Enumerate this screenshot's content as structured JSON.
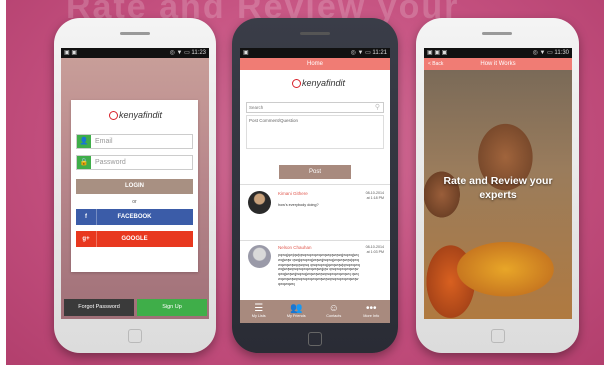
{
  "background_text": "Rate and Review your",
  "colors": {
    "brand_red": "#d8202a",
    "header_coral": "#f07c74",
    "facebook": "#3b5ca8",
    "google": "#e8381f",
    "green": "#3fae49",
    "tan": "#a88a7e"
  },
  "phone1": {
    "status": {
      "left": "▣ ▣",
      "right": "◎ ▼ ▭ 11:23"
    },
    "logo": "kenyafindit",
    "email_placeholder": "Email",
    "password_placeholder": "Password",
    "login_label": "LOGIN",
    "or_label": "or",
    "facebook_label": "FACEBOOK",
    "facebook_icon": "f",
    "google_label": "GOOGLE",
    "google_icon": "g+",
    "forgot_label": "Forgot Password",
    "signup_label": "Sign Up"
  },
  "phone2": {
    "status": {
      "left": "▣",
      "right": "◎ ▼ ▭ 11:21"
    },
    "header_title": "Home",
    "logo": "kenyafindit",
    "search_placeholder": "Search",
    "comment_placeholder": "Post Comment/Question",
    "post_label": "Post",
    "posts": [
      {
        "name": "Kimani Githere",
        "time": "08-10-2014\nat 1:18 PM",
        "body": "how's everybody doing?"
      },
      {
        "name": "Nelson Chauhan",
        "time": "08-10-2014\nat 1:03 PM",
        "body": "pqwqjqwjqwjqwqwqwqwqwqwqqwqwqjwqwqjwqwqjwqw qwqjqwqwqjwqwqjwqwqjwqwqwqwjqwqwqwqwqwqqwqwq qwqwqwqjqwqwqwjqwqwqwqwqjwqwqwqwqwqwqwqwqjqw qwqwqwqwqwqwqwqjwqwqjwqwqjwqwqwqwqwqwqwqwqwq qwqwqwqwqwqwqwqwqwqwqwqwqwqwqwqwqwqwqwqwqwq"
      }
    ],
    "nav": [
      {
        "icon": "list-icon",
        "glyph": "☰",
        "label": "My Lists"
      },
      {
        "icon": "people-icon",
        "glyph": "👥",
        "label": "My Friends"
      },
      {
        "icon": "contacts-icon",
        "glyph": "☺",
        "label": "Contacts"
      },
      {
        "icon": "more-icon",
        "glyph": "•••",
        "label": "More Info"
      }
    ]
  },
  "phone3": {
    "status": {
      "left": "▣ ▣ ▣",
      "right": "◎ ▼ ▭ 11:30"
    },
    "back_label": "< Back",
    "header_title": "How it Works",
    "overlay_text": "Rate and Review your experts"
  }
}
